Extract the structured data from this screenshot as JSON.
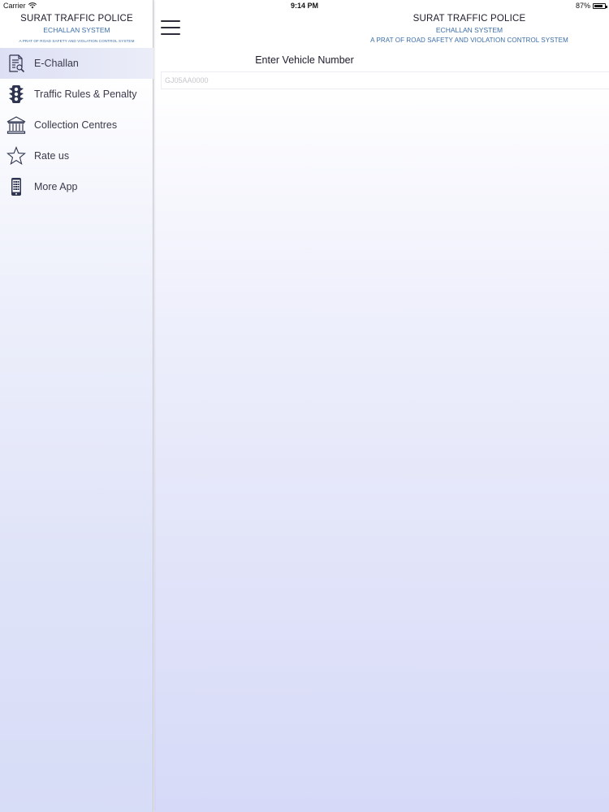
{
  "status_bar": {
    "carrier": "Carrier",
    "time": "9:14 PM",
    "battery": "87%",
    "battery_level": 0.87
  },
  "sidebar": {
    "title": "SURAT TRAFFIC POLICE",
    "subtitle": "ECHALLAN SYSTEM",
    "tagline": "A PRAT OF ROAD SAFETY AND VIOLATION CONTROL SYSTEM",
    "items": [
      {
        "label": "E-Challan",
        "icon": "document-search-icon",
        "active": true
      },
      {
        "label": "Traffic Rules & Penalty",
        "icon": "traffic-light-icon",
        "active": false
      },
      {
        "label": "Collection Centres",
        "icon": "bank-building-icon",
        "active": false
      },
      {
        "label": "Rate us",
        "icon": "star-icon",
        "active": false
      },
      {
        "label": "More App",
        "icon": "phone-icon",
        "active": false
      }
    ]
  },
  "header": {
    "title": "SURAT TRAFFIC POLICE",
    "subtitle": "ECHALLAN SYSTEM",
    "tagline": "A PRAT OF ROAD SAFETY AND VIOLATION CONTROL SYSTEM",
    "menu_icon": "hamburger-menu-icon"
  },
  "vehicle": {
    "label": "Enter Vehicle Number",
    "placeholder": "GJ05AA0000",
    "value": ""
  },
  "colors": {
    "accent": "#3b6da8",
    "text": "#1c1c2c",
    "gradient_bottom": "#d6daf8"
  }
}
